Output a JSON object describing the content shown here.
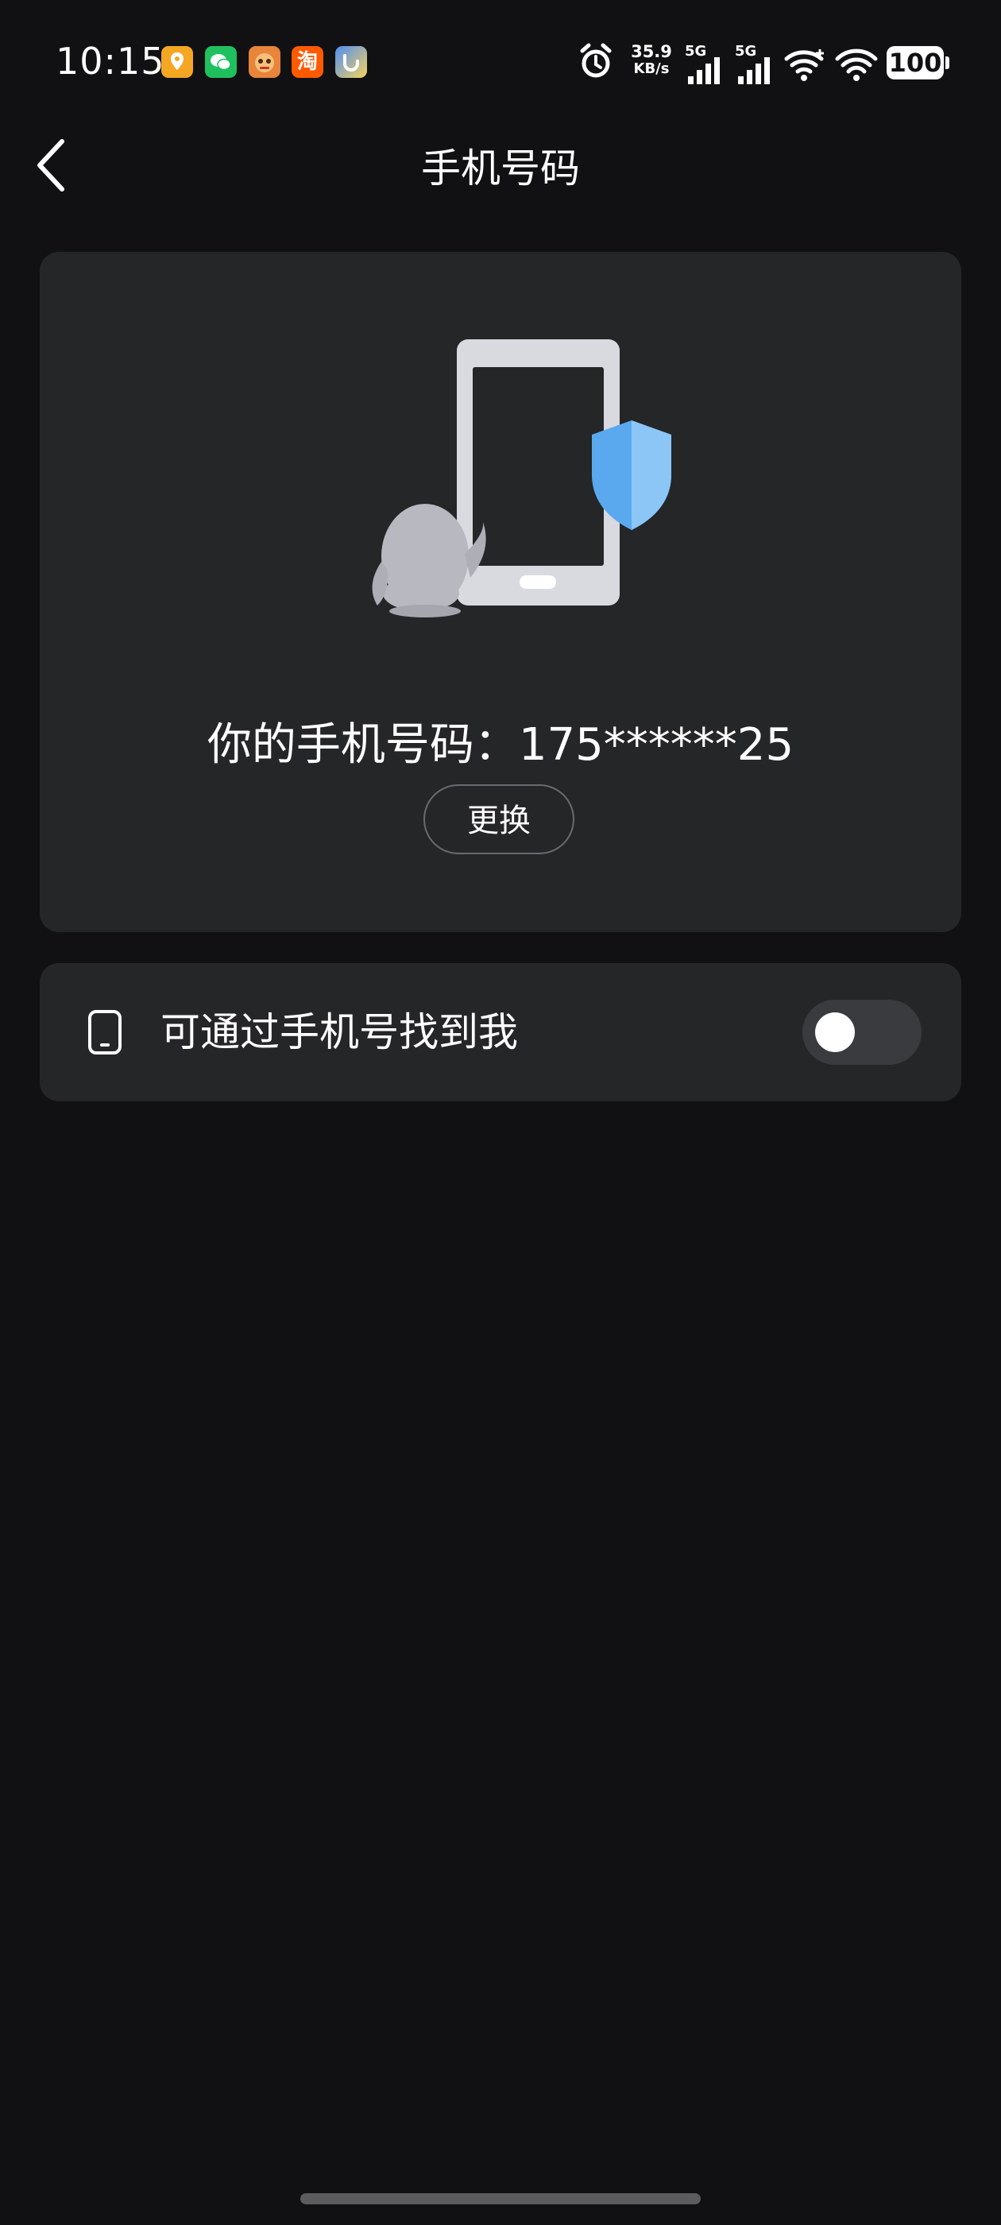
{
  "status_bar": {
    "time": "10:15",
    "net_speed_value": "35.9",
    "net_speed_unit": "KB/s",
    "signal1_label": "5G",
    "signal2_label": "5G",
    "battery": "100",
    "app_icons": [
      "map-app-icon",
      "wechat-icon",
      "game-app-icon",
      "taobao-icon",
      "browser-app-icon"
    ],
    "taobao_glyph": "淘"
  },
  "header": {
    "title": "手机号码"
  },
  "info_card": {
    "phone_text": "你的手机号码：175******25",
    "change_label": "更换"
  },
  "setting": {
    "label": "可通过手机号找到我",
    "enabled": false
  },
  "colors": {
    "background": "#111113",
    "card": "#252628",
    "shield_blue": "#5aa9ee",
    "toggle_off": "#3a3b3e"
  }
}
